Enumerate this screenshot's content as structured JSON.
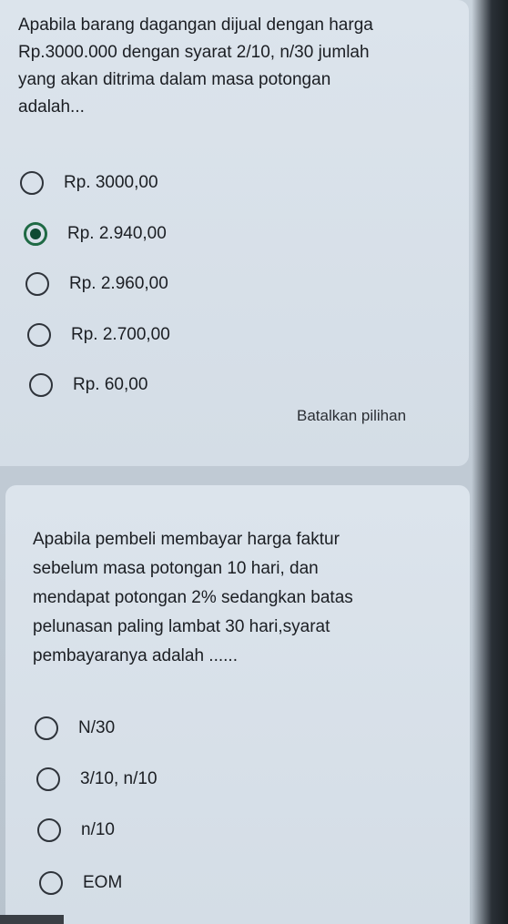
{
  "questions": [
    {
      "text": "Apabila barang dagangan dijual dengan harga\nRp.3000.000 dengan syarat 2/10, n/30 jumlah\nyang akan ditrima dalam masa potongan\nadalah...",
      "options": [
        {
          "label": "Rp. 3000,00",
          "selected": false
        },
        {
          "label": "Rp. 2.940,00",
          "selected": true
        },
        {
          "label": "Rp. 2.960,00",
          "selected": false
        },
        {
          "label": "Rp. 2.700,00",
          "selected": false
        },
        {
          "label": "Rp. 60,00",
          "selected": false
        }
      ],
      "clear_label": "Batalkan pilihan"
    },
    {
      "text": "Apabila pembeli membayar harga faktur\nsebelum masa potongan 10 hari, dan\nmendapat potongan 2% sedangkan batas\npelunasan paling lambat 30 hari,syarat\npembayaranya adalah ......",
      "options": [
        {
          "label": "N/30",
          "selected": false
        },
        {
          "label": "3/10, n/10",
          "selected": false
        },
        {
          "label": "n/10",
          "selected": false
        },
        {
          "label": "EOM",
          "selected": false
        }
      ]
    }
  ],
  "colors": {
    "selected_radio": "#1f6a45",
    "card_background": "#d8e0e8"
  }
}
